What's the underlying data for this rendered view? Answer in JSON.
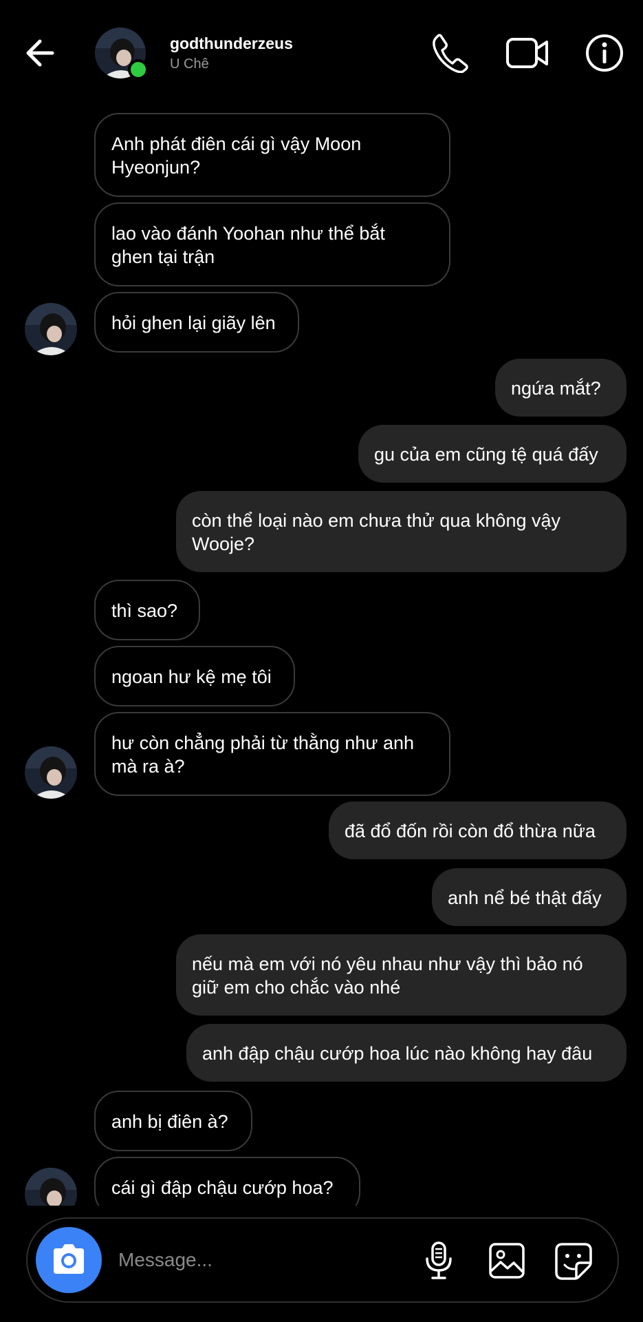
{
  "header": {
    "username": "godthunderzeus",
    "subtitle": "U Chê"
  },
  "messages": [
    {
      "dir": "in",
      "text": "Anh phát điên cái gì vậy Moon\nHyeonjun?"
    },
    {
      "dir": "in",
      "text": "lao vào đánh Yoohan như thể bắt\nghen tại trận"
    },
    {
      "dir": "in",
      "text": "hỏi ghen lại giãy lên"
    },
    {
      "dir": "out",
      "text": "ngứa mắt?"
    },
    {
      "dir": "out",
      "text": "gu của em cũng tệ quá đấy"
    },
    {
      "dir": "out",
      "text": "còn thể loại nào em chưa thử qua không vậy\nWooje?"
    },
    {
      "dir": "in",
      "text": "thì sao?"
    },
    {
      "dir": "in",
      "text": "ngoan hư kệ mẹ tôi"
    },
    {
      "dir": "in",
      "text": "hư còn chẳng phải từ thằng như anh\nmà ra à?"
    },
    {
      "dir": "out",
      "text": "đã đổ đốn rồi còn đổ thừa nữa"
    },
    {
      "dir": "out",
      "text": "anh nể bé thật đấy"
    },
    {
      "dir": "out",
      "text": "nếu mà em với nó yêu nhau như vậy thì bảo nó\ngiữ em cho chắc vào nhé"
    },
    {
      "dir": "out",
      "text": "anh đập chậu cướp hoa lúc nào không hay đâu"
    },
    {
      "dir": "in",
      "text": "anh bị điên à?"
    },
    {
      "dir": "in",
      "text": "cái gì đập chậu cướp hoa?"
    }
  ],
  "composer": {
    "placeholder": "Message..."
  },
  "colors": {
    "accent": "#3b82f6",
    "online": "#2ecc40",
    "outgoing_bubble": "#262626"
  }
}
